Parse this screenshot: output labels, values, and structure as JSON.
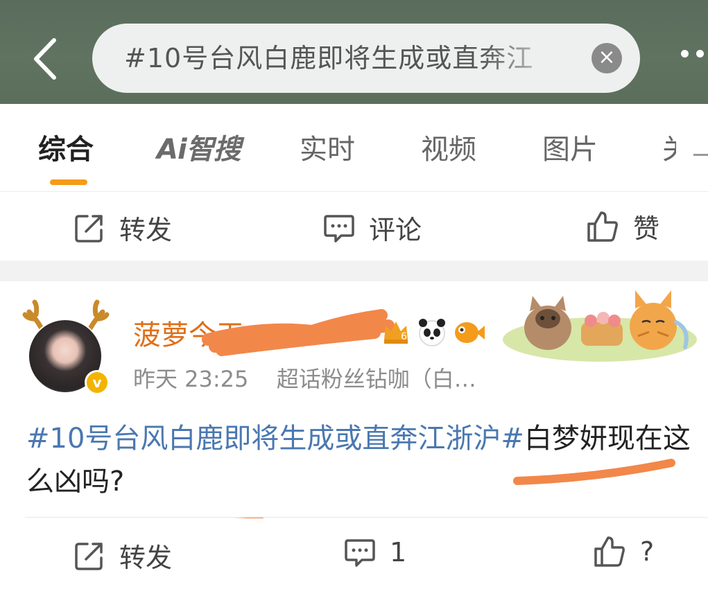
{
  "header": {
    "search_text": "#10号台风白鹿即将生成或直奔江"
  },
  "tabs": [
    {
      "label": "综合"
    },
    {
      "label": "Ai智搜"
    },
    {
      "label": "实时"
    },
    {
      "label": "视频"
    },
    {
      "label": "图片"
    },
    {
      "label": "关"
    }
  ],
  "top_actions": {
    "repost": "转发",
    "comment": "评论",
    "like": "赞"
  },
  "post": {
    "username": "菠萝今天…",
    "time": "昨天 23:25",
    "source": "超话粉丝钻咖（白…",
    "hashtag": "#10号台风白鹿即将生成或直奔江浙沪#",
    "text": "白梦妍现在这么凶吗?",
    "actions": {
      "repost": "转发",
      "comment_count": "1",
      "like": "?"
    }
  },
  "colors": {
    "header_bg": "#5f725f",
    "accent": "#f59b1a",
    "username": "#e06f19",
    "hashtag": "#4a78b0"
  }
}
